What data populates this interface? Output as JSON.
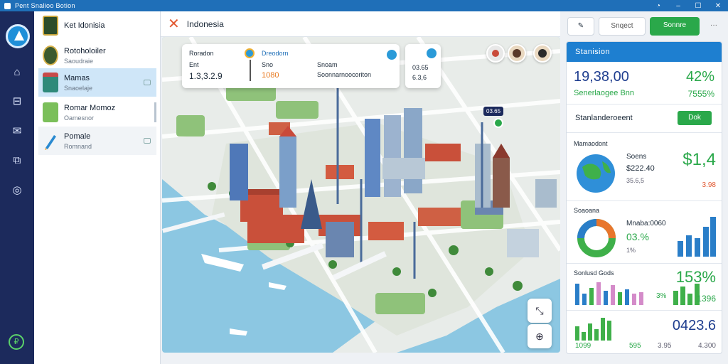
{
  "window": {
    "title": "Pent Snalioo Botion"
  },
  "list": {
    "items": [
      {
        "title": "Ket Idonisia",
        "subtitle": ""
      },
      {
        "title": "Rotoholoiler",
        "subtitle": "Saoudraie"
      },
      {
        "title": "Mamas",
        "subtitle": "Snaoelaje"
      },
      {
        "title": "Romar Momoz",
        "subtitle": "Oamesnor"
      },
      {
        "title": "Pomale",
        "subtitle": "Romnand"
      }
    ]
  },
  "map": {
    "title": "Indonesia",
    "popup1": {
      "label": "Roradon",
      "sub": "Ent",
      "value": "1.3,3.2.9"
    },
    "popup2": {
      "label": "Dreodorn",
      "sub": "Sno",
      "value": "1080",
      "line1": "Snoam",
      "line2": "Soonnarnoocoriton"
    },
    "popup3": {
      "value1": "03.65",
      "value2": "6.3,6"
    },
    "pin_label": "03.65"
  },
  "toolbar": {
    "search_label": "Snqect",
    "primary_label": "Sonnre",
    "more": "···"
  },
  "stats": {
    "header": "Stanision",
    "kpi": {
      "value": "19,38,00",
      "percent": "42%",
      "label": "Senerlaogee Bnn",
      "sub_percent": "7555%"
    },
    "section_row": {
      "label": "Stanlanderoeent",
      "button": "Dok"
    },
    "block1": {
      "title": "Mamaodont",
      "line1": "Soens",
      "line2": "$222.40",
      "line3": "35.6,5",
      "big": "$1,4",
      "small": "3.98"
    },
    "block2": {
      "title": "Soaoana",
      "line1": "Mnaba:0060",
      "percent": "03.%",
      "small": "1%"
    },
    "block3": {
      "title": "Sonlusd Gods",
      "percent": "153%",
      "small1": "3%",
      "small2": "1396"
    },
    "block4": {
      "value": "0423.6",
      "small1": "1099",
      "small2": "595",
      "small3": "3.95",
      "small4": "4.300"
    }
  },
  "colors": {
    "accent": "#1e7fd0",
    "primary_green": "#2aa84a",
    "rail": "#1c2a5c",
    "water": "#8cc7e2",
    "orange": "#e87a20"
  }
}
